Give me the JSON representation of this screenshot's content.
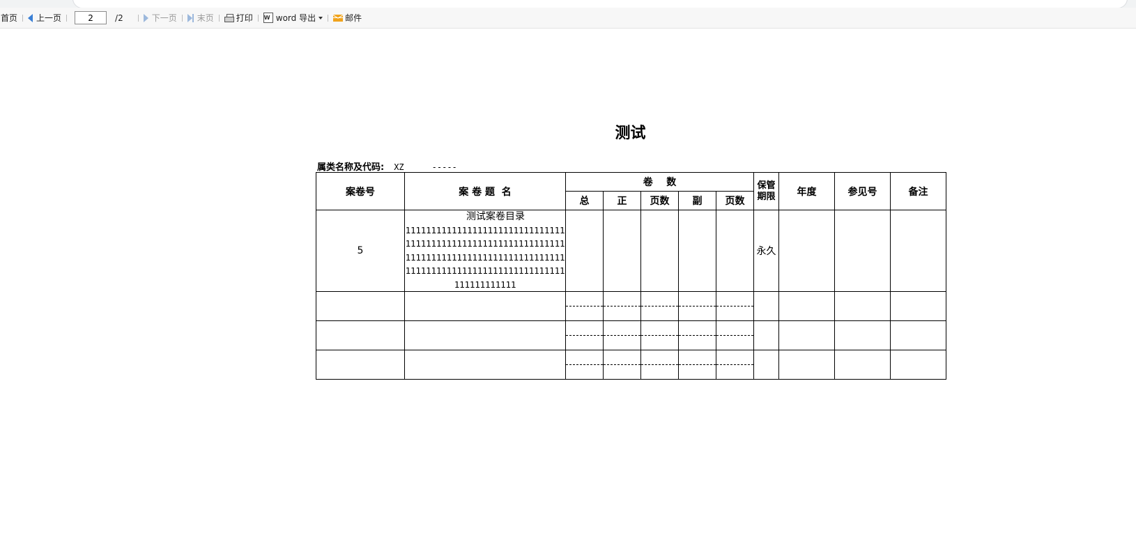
{
  "toolbar": {
    "first_page": "首页",
    "prev_page": "上一页",
    "current_page": "2",
    "total_pages": "/2",
    "next_page": "下一页",
    "last_page": "末页",
    "print": "打印",
    "word_export": "word 导出",
    "mail": "邮件",
    "icons": [
      "prev-triangle-icon",
      "next-triangle-icon",
      "last-page-icon",
      "printer-icon",
      "word-icon",
      "mail-icon"
    ]
  },
  "document": {
    "title": "测试",
    "category_label": "属类名称及代码:",
    "category_value": "XZ",
    "category_dash": "-----"
  },
  "table": {
    "headers": {
      "file_no": "案卷号",
      "file_title": "案 卷 题  名",
      "volumes": "卷    数",
      "total": "总",
      "main": "正",
      "main_pages": "页数",
      "copy": "副",
      "copy_pages": "页数",
      "retention_line1": "保管",
      "retention_line2": "期限",
      "year": "年度",
      "reference": "参见号",
      "remarks": "备注"
    },
    "rows": [
      {
        "file_no": "5",
        "title_main": "测试案卷目录",
        "title_sub": "1111111111111111111111111111111111111111111111111111111111111111111111111111111111111111111111111111111111111111111111111111111111111111",
        "retention": "永久",
        "year": "",
        "reference": "",
        "remarks": ""
      }
    ],
    "empty_rows": 3
  }
}
